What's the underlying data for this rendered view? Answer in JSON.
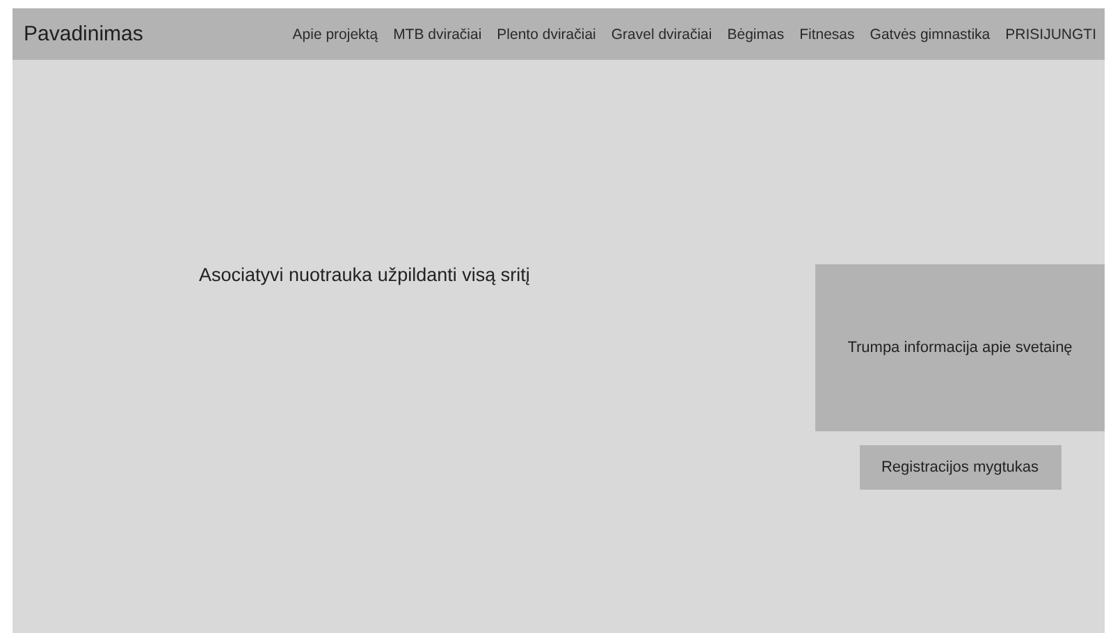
{
  "header": {
    "title": "Pavadinimas",
    "nav": [
      "Apie projektą",
      "MTB dviračiai",
      "Plento dviračiai",
      "Gravel dviračiai",
      "Bėgimas",
      "Fitnesas",
      "Gatvės gimnastika",
      "PRISIJUNGTI"
    ]
  },
  "hero": {
    "text": "Asociatyvi nuotrauka užpildanti visą sritį"
  },
  "info": {
    "text": "Trumpa informacija apie svetainę"
  },
  "button": {
    "label": "Registracijos mygtukas"
  }
}
